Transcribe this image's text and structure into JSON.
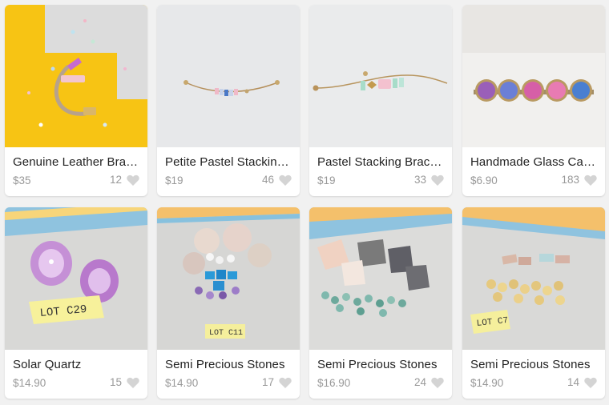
{
  "products": [
    {
      "title": "Genuine Leather Bracelet",
      "price": "$35",
      "likes": "12",
      "image": "leather-bracelet-photo"
    },
    {
      "title": "Petite Pastel Stacking Bracelet",
      "price": "$19",
      "likes": "46",
      "image": "petite-pastel-bracelet-photo"
    },
    {
      "title": "Pastel Stacking Bracelet",
      "price": "$19",
      "likes": "33",
      "image": "pastel-stacking-bracelet-photo"
    },
    {
      "title": "Handmade Glass Cabochon",
      "price": "$6.90",
      "likes": "183",
      "image": "glass-cabochon-photo"
    },
    {
      "title": "Solar Quartz",
      "price": "$14.90",
      "likes": "15",
      "image": "solar-quartz-photo",
      "tag": "LOT C29"
    },
    {
      "title": "Semi Precious Stones",
      "price": "$14.90",
      "likes": "17",
      "image": "semi-precious-stones-photo",
      "tag": "LOT C11"
    },
    {
      "title": "Semi Precious Stones",
      "price": "$16.90",
      "likes": "24",
      "image": "semi-precious-stones-photo-2"
    },
    {
      "title": "Semi Precious Stones",
      "price": "$14.90",
      "likes": "14",
      "image": "semi-precious-stones-photo-3",
      "tag": "LOT C7"
    }
  ],
  "icons": {
    "like": "heart-icon"
  },
  "colors": {
    "card_bg": "#ffffff",
    "page_bg": "#f1f1f1",
    "muted": "#999999",
    "heart": "#d4d4d4",
    "accent_yellow": "#f7c414"
  }
}
